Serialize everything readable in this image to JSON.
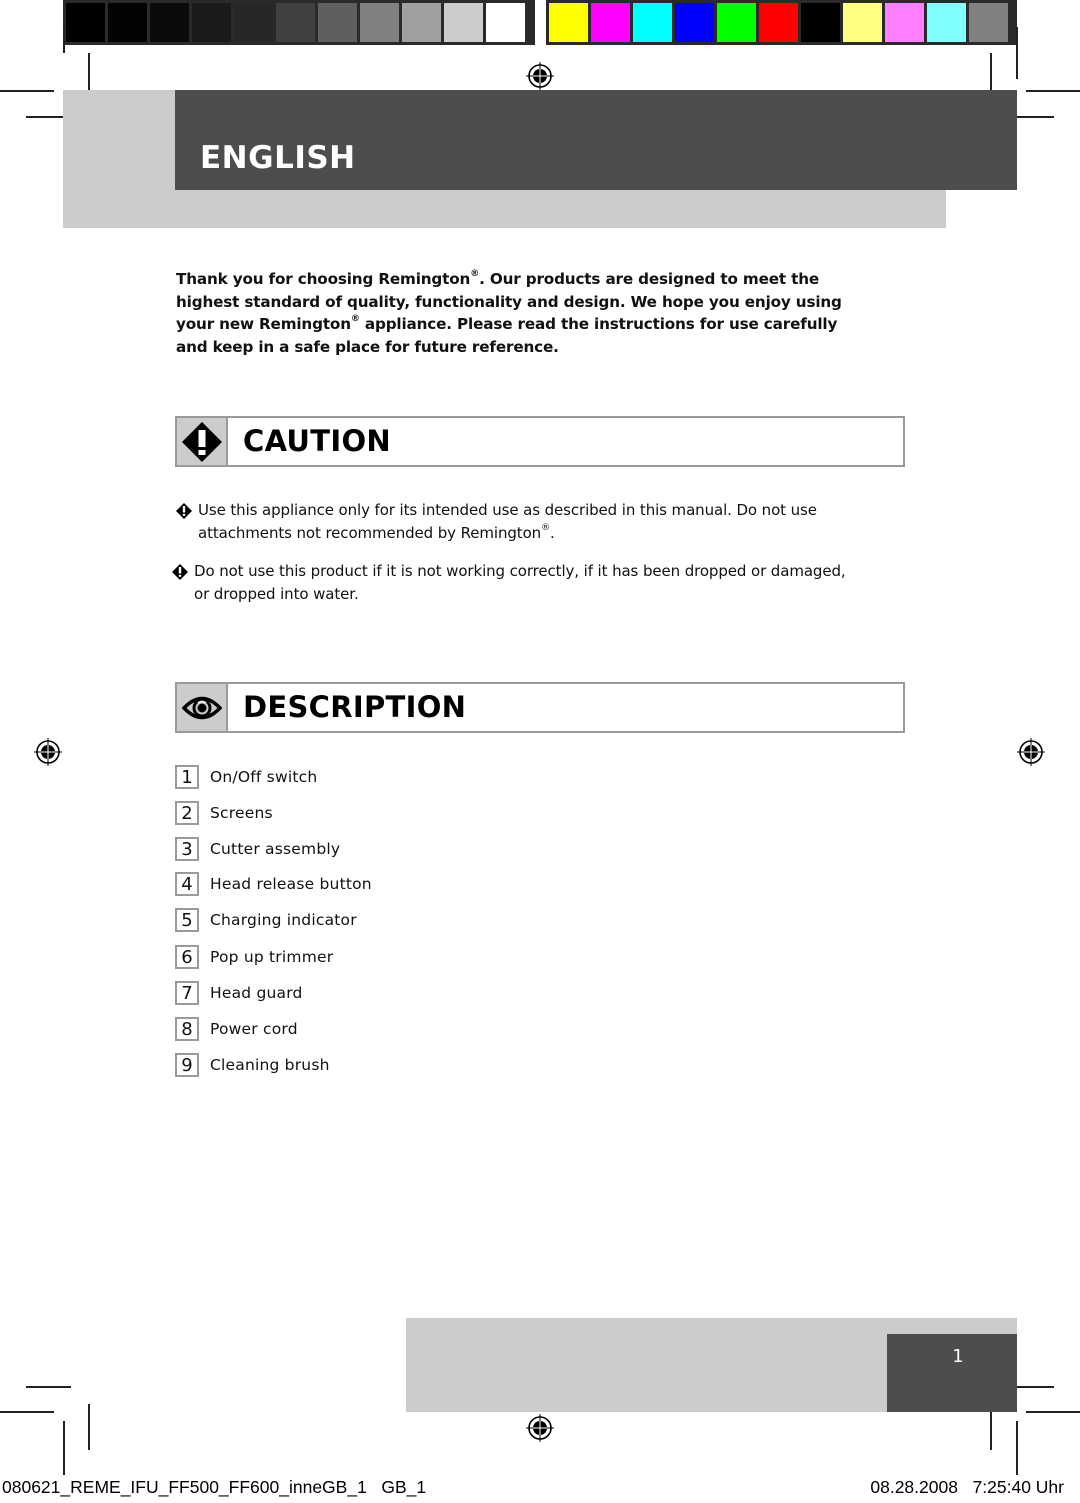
{
  "print_marks": {
    "gray_swatches": [
      "#000000",
      "#030303",
      "#0b0b0b",
      "#1a1a1a",
      "#272727",
      "#404040",
      "#5f5f5f",
      "#808080",
      "#a0a0a0",
      "#cccccc",
      "#ffffff"
    ],
    "color_swatches": [
      "#ffff00",
      "#ff00ff",
      "#00ffff",
      "#0000ff",
      "#00ff00",
      "#ff0000",
      "#000000",
      "#ffff80",
      "#ff80ff",
      "#80ffff",
      "#808080"
    ]
  },
  "header": {
    "title": "ENGLISH"
  },
  "intro": {
    "part1": "Thank you for choosing Remington",
    "reg1": "®",
    "part2": ". Our products are designed to meet the highest standard of quality, functionality and design. We hope you enjoy using your new Remington",
    "reg2": "®",
    "part3": " appliance. Please read the instructions for use carefully and keep in a safe place for future reference."
  },
  "caution": {
    "icon": "warning-diamond-icon",
    "title": "CAUTION",
    "bullets": [
      {
        "line1": "Use this appliance only for its intended use as described in this manual. Do not use",
        "line2": "attachments not recommended by Remington",
        "reg": "®",
        "tail": "."
      },
      {
        "line1": "Do not use this product if it is not working correctly, if it has been dropped or damaged,",
        "line2": "or dropped into water.",
        "reg": "",
        "tail": ""
      }
    ]
  },
  "description": {
    "icon": "eye-icon",
    "title": "DESCRIPTION",
    "items": [
      {
        "num": "1",
        "label": "On/Off switch"
      },
      {
        "num": "2",
        "label": "Screens"
      },
      {
        "num": "3",
        "label": "Cutter assembly"
      },
      {
        "num": "4",
        "label": "Head release button"
      },
      {
        "num": "5",
        "label": "Charging indicator"
      },
      {
        "num": "6",
        "label": "Pop up trimmer"
      },
      {
        "num": "7",
        "label": "Head guard"
      },
      {
        "num": "8",
        "label": "Power cord"
      },
      {
        "num": "9",
        "label": "Cleaning brush"
      }
    ]
  },
  "footer": {
    "page_number": "1",
    "slug_left": "080621_REME_IFU_FF500_FF600_inneGB_1   GB_1",
    "slug_right": "08.28.2008   7:25:40 Uhr"
  }
}
